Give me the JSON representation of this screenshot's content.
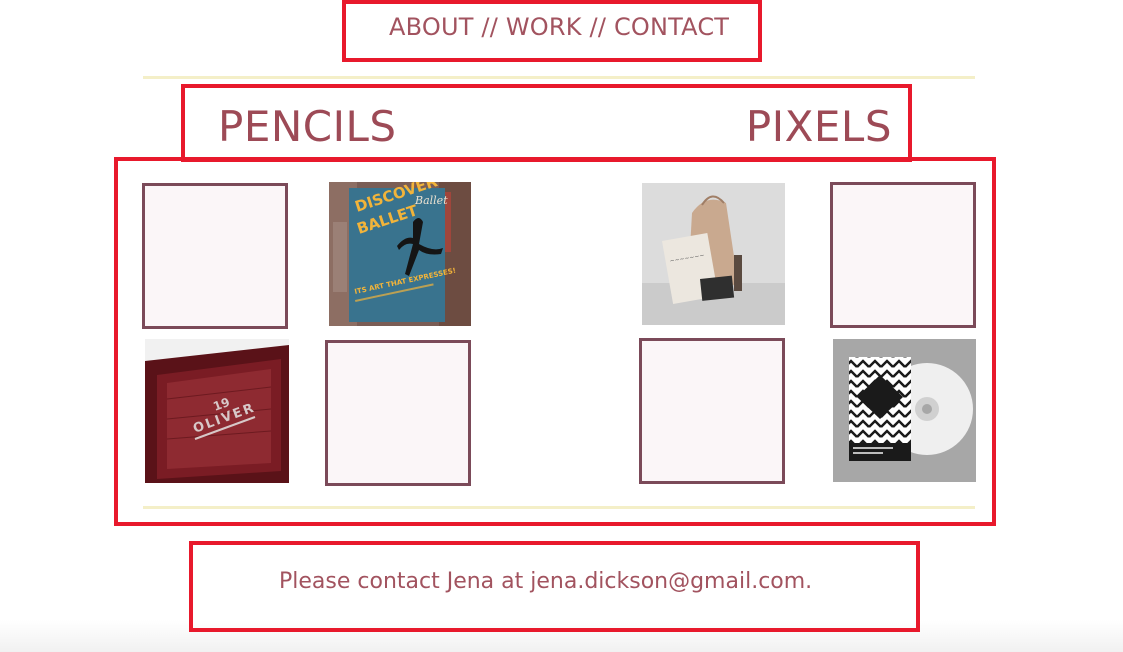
{
  "nav": {
    "items": [
      "ABOUT",
      "WORK",
      "CONTACT"
    ],
    "separator": "//"
  },
  "headings": {
    "left": "PENCILS",
    "right": "PIXELS"
  },
  "gallery": {
    "ballet_poster": {
      "line1": "DISCOVER",
      "line2": "BALLET",
      "script": "Ballet",
      "tagline": "ITS ART THAT EXPRESSES!"
    },
    "wood_box": {
      "number": "19",
      "brand": "OLIVER"
    }
  },
  "contact": {
    "text": "Please contact Jena at jena.dickson@gmail.com."
  },
  "colors": {
    "accent": "#a2535f",
    "highlight_box": "#e8192c",
    "rule": "#f4efc8",
    "thumb_border": "#7b4a59",
    "thumb_fill": "#fbf6f8"
  }
}
